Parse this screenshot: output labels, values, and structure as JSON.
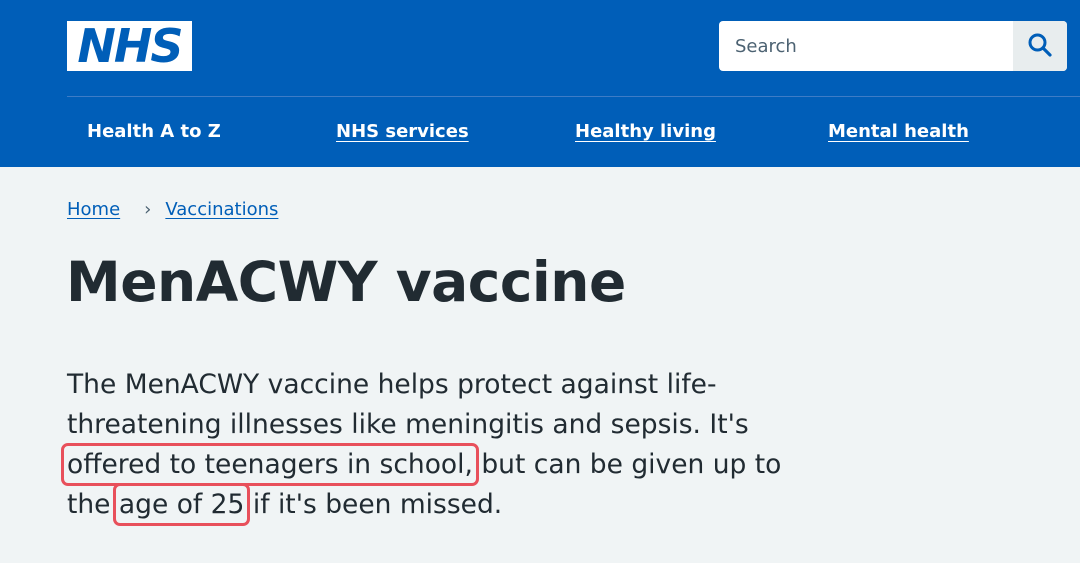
{
  "header": {
    "logo_text": "NHS",
    "search": {
      "placeholder": "Search",
      "button_icon": "search-icon"
    },
    "nav": [
      {
        "label": "Health A to Z"
      },
      {
        "label": "NHS services"
      },
      {
        "label": "Healthy living"
      },
      {
        "label": "Mental health"
      }
    ]
  },
  "breadcrumb": {
    "items": [
      {
        "label": "Home"
      },
      {
        "label": "Vaccinations"
      }
    ],
    "separator": "›"
  },
  "page": {
    "title": "MenACWY vaccine",
    "lede": {
      "line1": "The MenACWY vaccine helps protect against life-",
      "line2": "threatening illnesses like meningitis and sepsis. It's",
      "highlight1": "offered to teenagers in school,",
      "line3_rest": " but can be given up to",
      "line4_start": "the ",
      "highlight2": "age of 25",
      "line4_rest": " if it's been missed."
    }
  },
  "colors": {
    "header_bg": "#005eb8",
    "page_bg": "#f0f4f5",
    "text": "#212b32",
    "link": "#005eb8",
    "highlight_box": "#e8505b"
  }
}
